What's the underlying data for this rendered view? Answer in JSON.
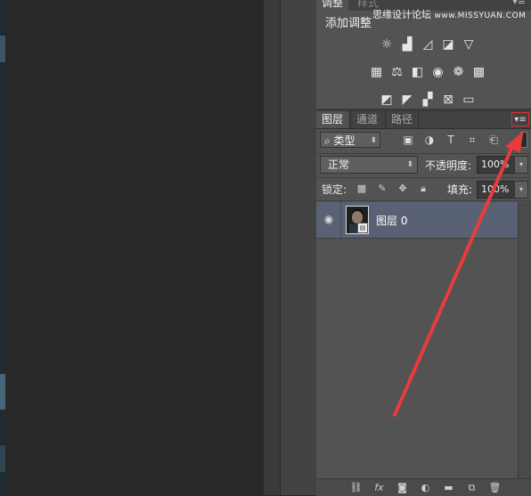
{
  "adjustments_panel": {
    "tab_active": "调整",
    "tab_inactive": "样式",
    "title": "添加调整",
    "menu_icon": "panel-menu-icon",
    "icon_rows": [
      [
        "brightness-contrast-icon",
        "levels-icon",
        "curves-icon",
        "exposure-icon",
        "vibrance-icon"
      ],
      [
        "hue-saturation-icon",
        "color-balance-icon",
        "black-white-icon",
        "photo-filter-icon",
        "channel-mixer-icon",
        "color-lookup-icon"
      ],
      [
        "invert-icon",
        "posterize-icon",
        "threshold-icon",
        "selective-color-icon",
        "gradient-map-icon"
      ]
    ]
  },
  "layers_panel": {
    "tabs": [
      "图层",
      "通道",
      "路径"
    ],
    "filter_kind_label": "类型",
    "blend_mode": "正常",
    "opacity_label": "不透明度:",
    "opacity_value": "100%",
    "lock_label": "锁定:",
    "fill_label": "填充:",
    "fill_value": "100%",
    "layers": [
      {
        "name": "图层 0",
        "visible": true,
        "selected": true
      }
    ]
  },
  "watermark": {
    "cn": "思缘设计论坛",
    "latin": "www.MISSYUAN.COM"
  },
  "colors": {
    "panel_bg": "#535353",
    "selected_layer": "#596274",
    "annotation_red": "#e83c3c"
  }
}
